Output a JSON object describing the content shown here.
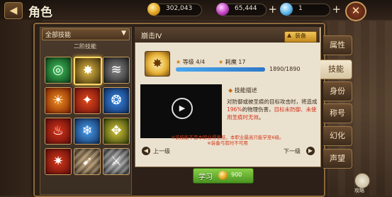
{
  "header": {
    "title": "角色",
    "back_icon": "back-arrow-icon",
    "resources": [
      {
        "icon": "gold-coin-icon",
        "value": "302,043"
      },
      {
        "icon": "gem-icon",
        "value": "65,444"
      },
      {
        "icon": "diamond-icon",
        "value": "1"
      }
    ],
    "plus_label": "+",
    "close_label": "✕"
  },
  "skills_panel": {
    "filter_selected": "全部技能",
    "tier_label": "二阶技能",
    "skills": [
      {
        "name": "wind-vortex",
        "colors": [
          "#0e3e1a",
          "#3ec25a"
        ],
        "glyph": "◎",
        "locked": false
      },
      {
        "name": "shatter",
        "colors": [
          "#3a2a08",
          "#e8c048"
        ],
        "glyph": "✸",
        "locked": false
      },
      {
        "name": "whirl",
        "colors": [
          "#1e1e1e",
          "#8a8a8a"
        ],
        "glyph": "≋",
        "locked": false
      },
      {
        "name": "flame-stance",
        "colors": [
          "#7a1c00",
          "#f29020"
        ],
        "glyph": "☀",
        "locked": false
      },
      {
        "name": "burst",
        "colors": [
          "#6a0e0e",
          "#e24a1a"
        ],
        "glyph": "✦",
        "locked": false
      },
      {
        "name": "spirit",
        "colors": [
          "#0e2a5a",
          "#3a8ae8"
        ],
        "glyph": "❂",
        "locked": false
      },
      {
        "name": "fire-pillar",
        "colors": [
          "#5a0a0a",
          "#d8361a"
        ],
        "glyph": "♨",
        "locked": false
      },
      {
        "name": "ice-spirit",
        "colors": [
          "#0e2a5a",
          "#4aa0f0"
        ],
        "glyph": "❄",
        "locked": false
      },
      {
        "name": "arrow-rain",
        "colors": [
          "#2a3808",
          "#d8c83a"
        ],
        "glyph": "✥",
        "locked": false
      },
      {
        "name": "blaze",
        "colors": [
          "#5a0a0a",
          "#d83a1a"
        ],
        "glyph": "✷",
        "locked": false
      },
      {
        "name": "dash",
        "colors": [
          "#4a3a2a",
          "#c8a878"
        ],
        "glyph": "➹",
        "locked": true
      },
      {
        "name": "blade-strike",
        "colors": [
          "#3a3a3a",
          "#b8b8b8"
        ],
        "glyph": "⚔",
        "locked": true
      }
    ]
  },
  "detail": {
    "skill_name": "崩击Ⅳ",
    "equip_label": "装备",
    "level_label": "等级",
    "level_value": "4/4",
    "mana_label": "耗魔",
    "mana_value": "17",
    "exp_text": "1890/1890",
    "exp_progress": 1.0,
    "desc_title": "技能描述",
    "desc_part1": "对防御或被圣痕的目标攻击时，将造成",
    "desc_highlight1": "196%",
    "desc_part2": "的物理伤害，",
    "desc_highlight2": "目标未防御、未使用圣痕时无效",
    "desc_part3": "。",
    "note_line1": "※该技能不是本职业得意技，本职业最高只能学至6级。",
    "note_line2": "※装备弓箭时不可用",
    "prev_label": "上一级",
    "next_label": "下一级",
    "learn_label": "学习",
    "learn_cost": "900"
  },
  "tabs": [
    "属性",
    "技能",
    "身份",
    "称号",
    "幻化",
    "声望"
  ],
  "active_tab": 1,
  "guide_label": "攻略"
}
